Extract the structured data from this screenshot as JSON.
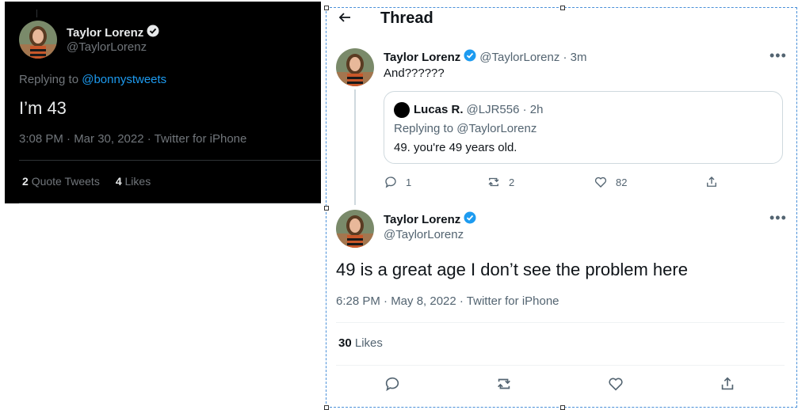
{
  "left_tweet": {
    "name": "Taylor Lorenz",
    "handle": "@TaylorLorenz",
    "replying_prefix": "Replying to",
    "replying_to": "@bonnystweets",
    "text": "I’m 43",
    "meta": "3:08 PM · Mar 30, 2022 · Twitter for iPhone",
    "quote_count": "2",
    "quote_label": "Quote Tweets",
    "like_count": "4",
    "like_label": "Likes"
  },
  "thread": {
    "title": "Thread",
    "tweet1": {
      "name": "Taylor Lorenz",
      "handle_time": "@TaylorLorenz · 3m",
      "text": "And??????",
      "quote": {
        "name": "Lucas R.",
        "handle_time": "@LJR556 · 2h",
        "replying": "Replying to @TaylorLorenz",
        "text": "49. you're 49 years old."
      },
      "replies": "1",
      "retweets": "2",
      "likes": "82"
    },
    "tweet2": {
      "name": "Taylor Lorenz",
      "handle": "@TaylorLorenz",
      "text": "49 is a great age I don’t see the problem here",
      "meta": "6:28 PM · May 8, 2022 · Twitter for iPhone",
      "like_count": "30",
      "like_label": "Likes"
    }
  },
  "colors": {
    "verified_blue": "#1d9bf0",
    "dark_bg": "#000000",
    "muted_text": "#536471",
    "selection_border": "#4a90d9"
  },
  "icons": [
    "back-arrow-icon",
    "verified-icon",
    "more-icon",
    "reply-icon",
    "retweet-icon",
    "like-icon",
    "share-icon"
  ]
}
